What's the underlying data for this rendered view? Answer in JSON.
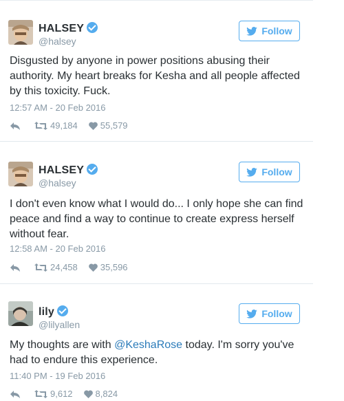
{
  "tweets": [
    {
      "name": "HALSEY",
      "handle": "@halsey",
      "follow_label": "Follow",
      "text": "Disgusted by anyone in power positions abusing their authority. My heart breaks for Kesha and all people affected by this toxicity. Fuck.",
      "timestamp": "12:57 AM - 20 Feb 2016",
      "retweets": "49,184",
      "likes": "55,579"
    },
    {
      "name": "HALSEY",
      "handle": "@halsey",
      "follow_label": "Follow",
      "text": "I don't even know what I would do... I only hope she can find peace and find a way to continue to create express herself without fear.",
      "timestamp": "12:58 AM - 20 Feb 2016",
      "retweets": "24,458",
      "likes": "35,596"
    },
    {
      "name": "lily",
      "handle": "@lilyallen",
      "follow_label": "Follow",
      "text_before": "My thoughts are with ",
      "mention": "@KeshaRose",
      "text_after": " today. I'm sorry you've had to endure this experience.",
      "timestamp": "11:40 PM - 19 Feb 2016",
      "retweets": "9,612",
      "likes": "8,824"
    }
  ],
  "colors": {
    "accent": "#55acee",
    "link": "#2b7bb9",
    "muted": "#8899a6",
    "text": "#292f33"
  },
  "icons": [
    "verified-badge-icon",
    "twitter-bird-icon",
    "reply-icon",
    "retweet-icon",
    "heart-icon"
  ]
}
